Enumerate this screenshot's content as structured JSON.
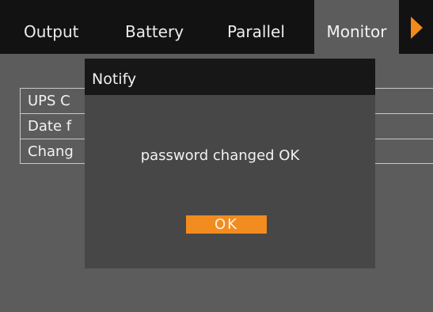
{
  "tabs": {
    "output": "Output",
    "battery": "Battery",
    "parallel": "Parallel",
    "monitor": "Monitor"
  },
  "settings_list": [
    "UPS C",
    "Date f",
    "Chang"
  ],
  "dialog": {
    "title": "Notify",
    "message": "password changed OK",
    "ok_label": "OK"
  },
  "colors": {
    "accent": "#f28c1e",
    "background": "#5c5c5c",
    "header": "#121212"
  }
}
